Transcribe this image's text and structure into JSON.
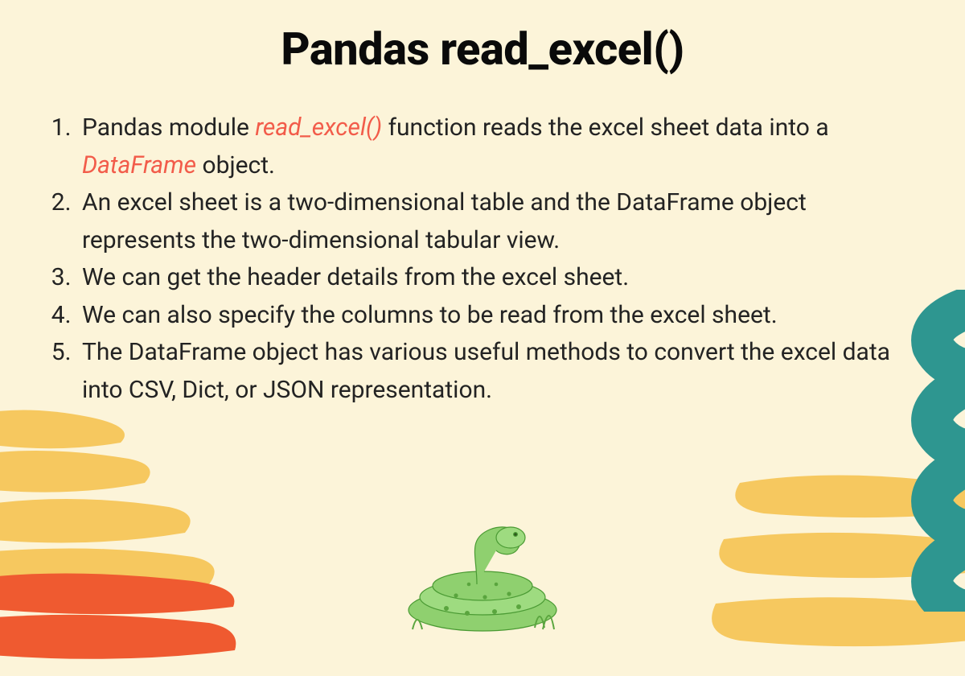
{
  "title": "Pandas read_excel()",
  "colors": {
    "background": "#fcf4d9",
    "text": "#232323",
    "highlight": "#f25c4a",
    "yellow": "#f6c85f",
    "orange": "#ef5a30",
    "teal": "#2e9690",
    "snake": "#6fbf4f"
  },
  "list": [
    {
      "pre": "Pandas module ",
      "hl1": "read_excel()",
      "mid": " function reads the excel sheet data into a ",
      "hl2": "DataFrame",
      "post": " object."
    },
    {
      "text": "An excel sheet is a two-dimensional table and the DataFrame object represents the two-dimensional tabular view."
    },
    {
      "text": "We can get the header details from the excel sheet."
    },
    {
      "text": "We can also specify the columns to be read from the excel sheet."
    },
    {
      "text": "The DataFrame object has various useful methods to convert the excel data into CSV, Dict, or JSON representation."
    }
  ]
}
